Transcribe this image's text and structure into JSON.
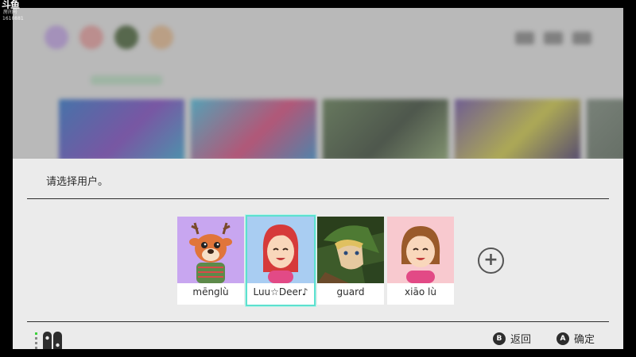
{
  "watermark": {
    "logo": "斗鱼",
    "sub": "房间号",
    "room_id": "1610881"
  },
  "dialog": {
    "title": "请选择用户。"
  },
  "users": [
    {
      "name": "mēnglù",
      "avatar_icon": "deer-villager-avatar",
      "bg_color": "#c8a6f0",
      "selected": false
    },
    {
      "name": "Luu☆Deer♪",
      "avatar_icon": "mii-red-hair-avatar",
      "bg_color": "#a9cdf2",
      "selected": true
    },
    {
      "name": "guard",
      "avatar_icon": "link-hero-avatar",
      "bg_color": "#3d5b2a",
      "selected": false
    },
    {
      "name": "xiāo lù",
      "avatar_icon": "mii-brown-hair-avatar",
      "bg_color": "#f8c9cf",
      "selected": false
    }
  ],
  "add_user": {
    "icon": "plus-icon"
  },
  "footer": {
    "controller_icon": "joycon-controllers-icon",
    "back": {
      "button": "B",
      "label": "返回"
    },
    "confirm": {
      "button": "A",
      "label": "确定"
    }
  },
  "colors": {
    "selection": "#5de0cf",
    "dialog_bg": "#ebebeb",
    "text": "#2d2d2d"
  }
}
